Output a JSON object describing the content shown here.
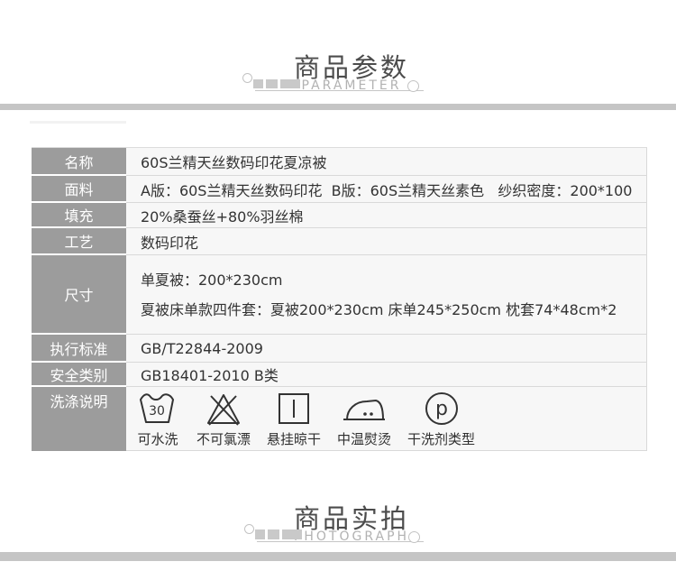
{
  "sections": {
    "parameters": {
      "title": "商品参数",
      "subtitle": "PARAMETER"
    },
    "photograph": {
      "title": "商品实拍",
      "subtitle": "PHOTOGRAPH"
    }
  },
  "table": {
    "rows": [
      {
        "label": "名称",
        "value": "60S兰精天丝数码印花夏凉被"
      },
      {
        "label": "面料",
        "value": "A版：60S兰精天丝数码印花  B版：60S兰精天丝素色   纱织密度：200*100"
      },
      {
        "label": "填充",
        "value": "20%桑蚕丝+80%羽丝棉"
      },
      {
        "label": "工艺",
        "value": "数码印花"
      },
      {
        "label": "尺寸",
        "lines": [
          "单夏被：200*230cm",
          "夏被床单款四件套：夏被200*230cm 床单245*250cm 枕套74*48cm*2"
        ]
      },
      {
        "label": "执行标准",
        "value": "GB/T22844-2009"
      },
      {
        "label": "安全类别",
        "value": "GB18401-2010 B类"
      },
      {
        "label": "洗涤说明"
      }
    ]
  },
  "care_icons": [
    {
      "name": "wash-30-icon",
      "label": "可水洗",
      "temp": "30"
    },
    {
      "name": "no-bleach-icon",
      "label": "不可氯漂"
    },
    {
      "name": "hang-dry-icon",
      "label": "悬挂晾干"
    },
    {
      "name": "iron-medium-icon",
      "label": "中温熨烫"
    },
    {
      "name": "dry-clean-p-icon",
      "label": "干洗剂类型",
      "letter": "p"
    }
  ],
  "colors": {
    "label_bg": "#9c9c9c",
    "bar_gray": "#c5c5c5",
    "title_text": "#4c4c4c",
    "subtitle_text": "#b2b2b2",
    "value_text": "#333333",
    "cell_bg": "#f7f7f7"
  }
}
